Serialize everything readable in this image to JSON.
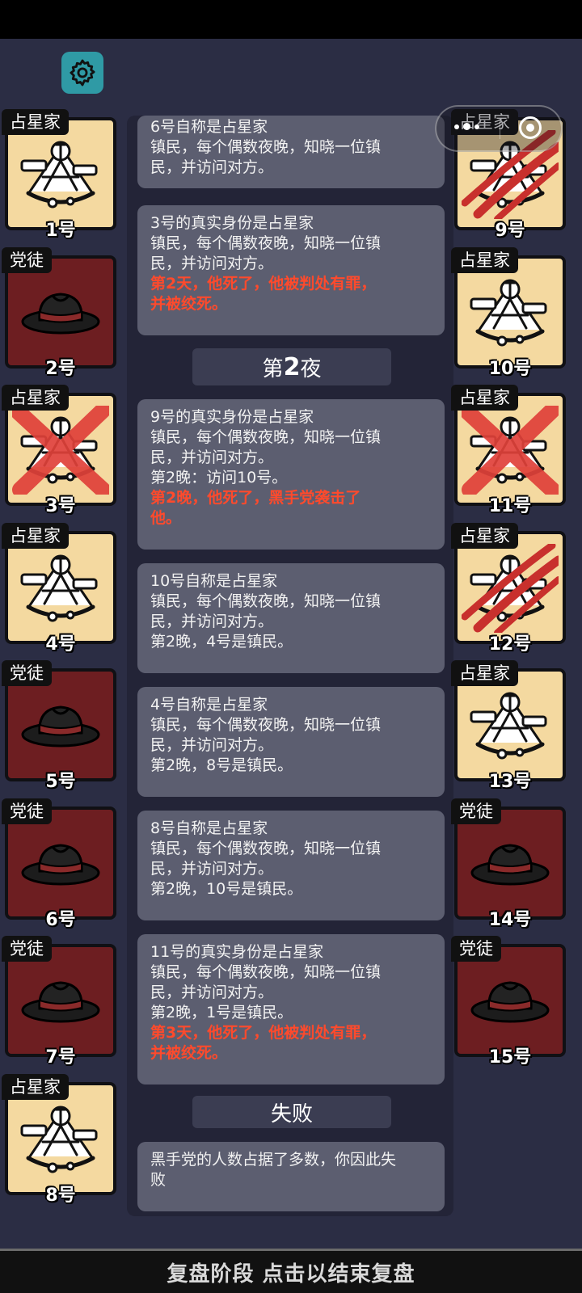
{
  "settings_icon": "gear-icon",
  "capsule": {
    "more_icon": "more-dots-icon",
    "close_icon": "target-close-icon"
  },
  "players_left": [
    {
      "role": "占星家",
      "num": "1号",
      "type": "astrologer",
      "mark": ""
    },
    {
      "role": "党徒",
      "num": "2号",
      "type": "mafia",
      "mark": ""
    },
    {
      "role": "占星家",
      "num": "3号",
      "type": "astrologer",
      "mark": "x"
    },
    {
      "role": "占星家",
      "num": "4号",
      "type": "astrologer",
      "mark": ""
    },
    {
      "role": "党徒",
      "num": "5号",
      "type": "mafia",
      "mark": ""
    },
    {
      "role": "党徒",
      "num": "6号",
      "type": "mafia",
      "mark": ""
    },
    {
      "role": "党徒",
      "num": "7号",
      "type": "mafia",
      "mark": ""
    },
    {
      "role": "占星家",
      "num": "8号",
      "type": "astrologer",
      "mark": ""
    }
  ],
  "players_right": [
    {
      "role": "占星家",
      "num": "9号",
      "type": "astrologer",
      "mark": "claw"
    },
    {
      "role": "占星家",
      "num": "10号",
      "type": "astrologer",
      "mark": ""
    },
    {
      "role": "占星家",
      "num": "11号",
      "type": "astrologer",
      "mark": "x"
    },
    {
      "role": "占星家",
      "num": "12号",
      "type": "astrologer",
      "mark": "claw"
    },
    {
      "role": "占星家",
      "num": "13号",
      "type": "astrologer",
      "mark": ""
    },
    {
      "role": "党徒",
      "num": "14号",
      "type": "mafia",
      "mark": ""
    },
    {
      "role": "党徒",
      "num": "15号",
      "type": "mafia",
      "mark": ""
    }
  ],
  "log": {
    "card1": {
      "l1": "6号自称是占星家",
      "l2": "镇民，每个偶数夜晚，知晓一位镇",
      "l3": "民，并访问对方。"
    },
    "card2": {
      "l1": "3号的真实身份是占星家",
      "l2": "镇民，每个偶数夜晚，知晓一位镇",
      "l3": "民，并访问对方。",
      "r1": "第2天，他死了，他被判处有罪，",
      "r2": "并被绞死。"
    },
    "banner_night": {
      "prefix": "第",
      "num": "2",
      "suffix": "夜"
    },
    "card3": {
      "l1": "9号的真实身份是占星家",
      "l2": "镇民，每个偶数夜晚，知晓一位镇",
      "l3": "民，并访问对方。",
      "l4": "第2晚：访问10号。",
      "r1": "第2晚，他死了，黑手党袭击了",
      "r2": "他。"
    },
    "card4": {
      "l1": "10号自称是占星家",
      "l2": "镇民，每个偶数夜晚，知晓一位镇",
      "l3": "民，并访问对方。",
      "l4": "第2晚，4号是镇民。"
    },
    "card5": {
      "l1": "4号自称是占星家",
      "l2": "镇民，每个偶数夜晚，知晓一位镇",
      "l3": "民，并访问对方。",
      "l4": "第2晚，8号是镇民。"
    },
    "card6": {
      "l1": "8号自称是占星家",
      "l2": "镇民，每个偶数夜晚，知晓一位镇",
      "l3": "民，并访问对方。",
      "l4": "第2晚，10号是镇民。"
    },
    "card7": {
      "l1": "11号的真实身份是占星家",
      "l2": "镇民，每个偶数夜晚，知晓一位镇",
      "l3": "民，并访问对方。",
      "l4": "第2晚，1号是镇民。",
      "r1": "第3天，他死了，他被判处有罪，",
      "r2": "并被绞死。"
    },
    "banner_result": "失败",
    "card8": {
      "l1": "黑手党的人数占据了多数，你因此失",
      "l2": "败"
    }
  },
  "bottom_bar": "复盘阶段 点击以结束复盘",
  "colors": {
    "astrologer_bg": "#f4d9a0",
    "mafia_bg": "#6d1e21",
    "death_red": "#ff4a2c",
    "settings_bg": "#2f9aa5"
  }
}
